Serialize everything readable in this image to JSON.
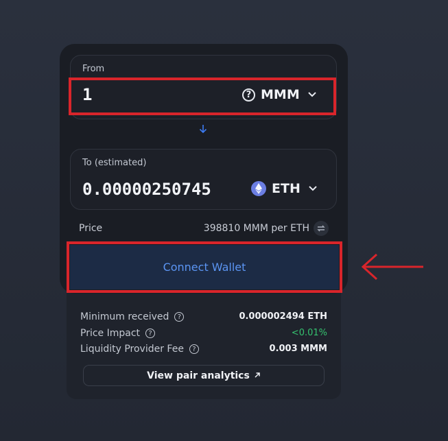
{
  "from": {
    "label": "From",
    "amount": "1",
    "token": "MMM",
    "token_icon": "question-circle-icon"
  },
  "to": {
    "label": "To (estimated)",
    "amount": "0.00000250745",
    "token": "ETH",
    "token_icon": "ethereum-icon"
  },
  "price": {
    "label": "Price",
    "value": "398810 MMM per ETH"
  },
  "connect_button": "Connect Wallet",
  "details": {
    "min_received_label": "Minimum received",
    "min_received_value": "0.000002494 ETH",
    "price_impact_label": "Price Impact",
    "price_impact_value": "<0.01%",
    "lp_fee_label": "Liquidity Provider Fee",
    "lp_fee_value": "0.003 MMM"
  },
  "analytics_button": "View pair analytics",
  "colors": {
    "accent": "#5b95f3",
    "highlight": "#d9252b",
    "positive": "#35c26f"
  }
}
